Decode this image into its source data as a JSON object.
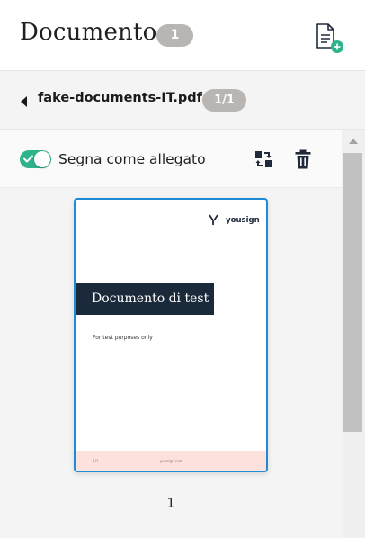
{
  "header": {
    "title": "Documento",
    "document_count": "1",
    "add_document_icon": "document-add-icon"
  },
  "file": {
    "name": "fake-documents-IT.pdf",
    "page_indicator": "1/1",
    "back_icon": "caret-left-icon"
  },
  "toolbar": {
    "attachment_toggle_label": "Segna come allegato",
    "attachment_toggle_on": true,
    "rotate_icon": "rotate-icon",
    "delete_icon": "trash-icon"
  },
  "preview": {
    "brand": "yousign",
    "banner_title": "Documento di test",
    "note": "For test purposes only",
    "footer_left": "1/1",
    "footer_center": "yousign.com",
    "page_number": "1"
  },
  "colors": {
    "accent_green": "#2fb38c",
    "badge_gray": "#b9b5b2",
    "selection_blue": "#1f8ad6",
    "banner_navy": "#1b2a3a",
    "footer_pink": "#fde1dd"
  }
}
